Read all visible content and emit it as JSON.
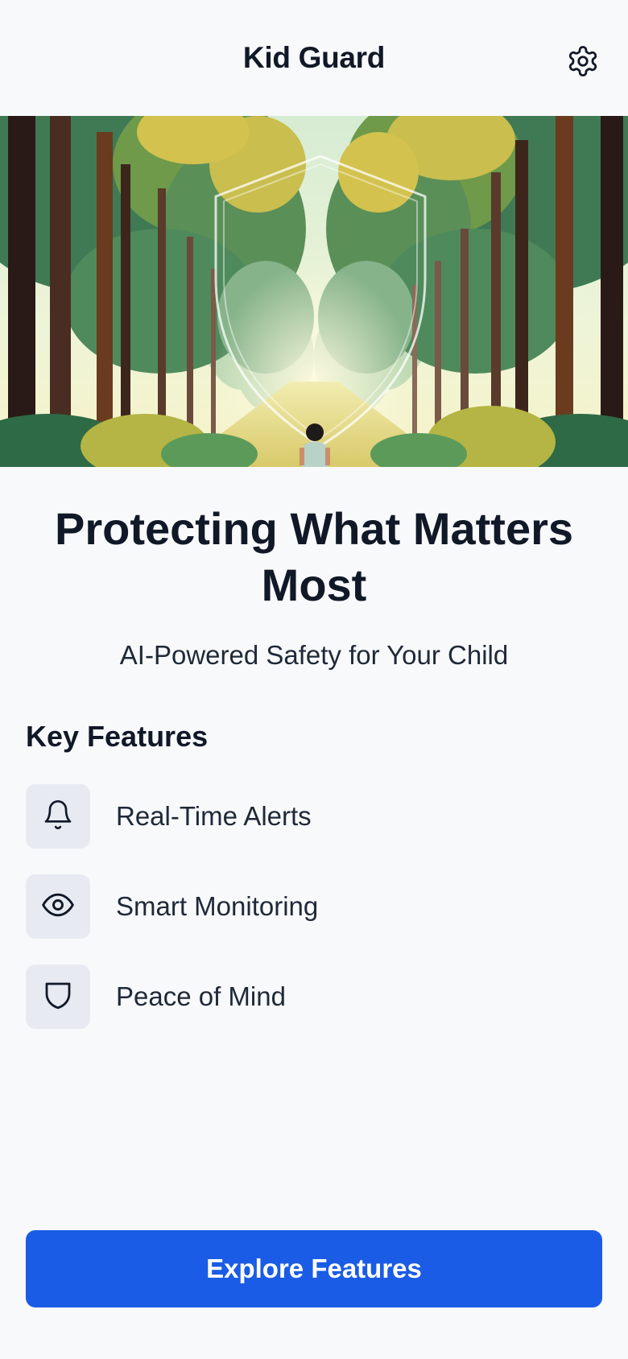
{
  "header": {
    "title": "Kid Guard",
    "settings_icon": "gear-icon"
  },
  "hero": {
    "image": "forest-path-with-shield-and-child-illustration"
  },
  "main": {
    "headline": "Protecting What Matters Most",
    "subtitle": "AI-Powered Safety for Your Child"
  },
  "features": {
    "title": "Key Features",
    "items": [
      {
        "label": "Real-Time Alerts",
        "icon": "bell-icon"
      },
      {
        "label": "Smart Monitoring",
        "icon": "eye-icon"
      },
      {
        "label": "Peace of Mind",
        "icon": "shield-icon"
      }
    ]
  },
  "cta": {
    "label": "Explore Features"
  },
  "colors": {
    "background": "#f8f9fb",
    "primary": "#1a5ce5",
    "icon_tile": "#e7ebf1",
    "text": "#111827"
  }
}
